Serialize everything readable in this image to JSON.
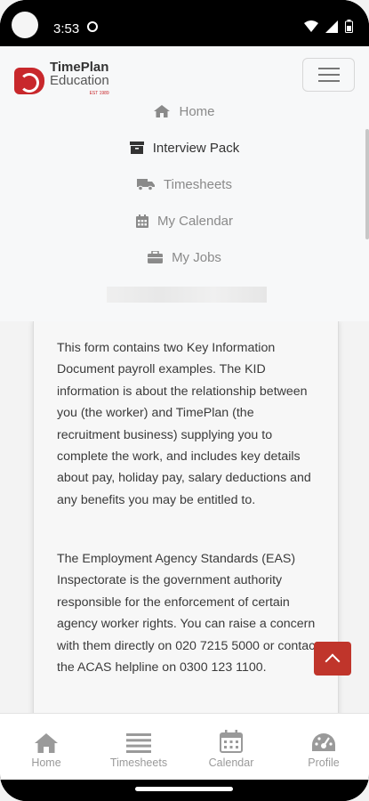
{
  "status_bar": {
    "time": "3:53"
  },
  "app": {
    "logo_line1": "TimePlan",
    "logo_line2": "Education",
    "logo_tagline": "EST 1989"
  },
  "nav": {
    "items": [
      {
        "label": "Home",
        "icon": "home-icon",
        "active": false
      },
      {
        "label": "Interview Pack",
        "icon": "box-icon",
        "active": true
      },
      {
        "label": "Timesheets",
        "icon": "truck-icon",
        "active": false
      },
      {
        "label": "My Calendar",
        "icon": "calendar-icon",
        "active": false
      },
      {
        "label": "My Jobs",
        "icon": "briefcase-icon",
        "active": false
      }
    ]
  },
  "content": {
    "paragraphs": [
      "This form contains two Key Information Document payroll examples. The KID information is about the relationship between you (the worker) and TimePlan (the recruitment business) supplying you to complete the work, and includes key details about pay, holiday pay, salary deductions and any benefits you may be entitled to.",
      "The Employment Agency Standards (EAS) Inspectorate is the government authority responsible for the enforcement of certain agency worker rights. You can raise a concern with them directly on 020 7215 5000 or contact the ACAS helpline on 0300 123 1100."
    ]
  },
  "tabbar": {
    "items": [
      {
        "label": "Home",
        "icon": "home-icon"
      },
      {
        "label": "Timesheets",
        "icon": "list-icon"
      },
      {
        "label": "Calendar",
        "icon": "calendar-icon"
      },
      {
        "label": "Profile",
        "icon": "dashboard-icon"
      }
    ]
  },
  "colors": {
    "accent": "#c0352b",
    "brand_red": "#c8282c",
    "text": "#3a3a3a",
    "muted": "#8a8a8a"
  }
}
